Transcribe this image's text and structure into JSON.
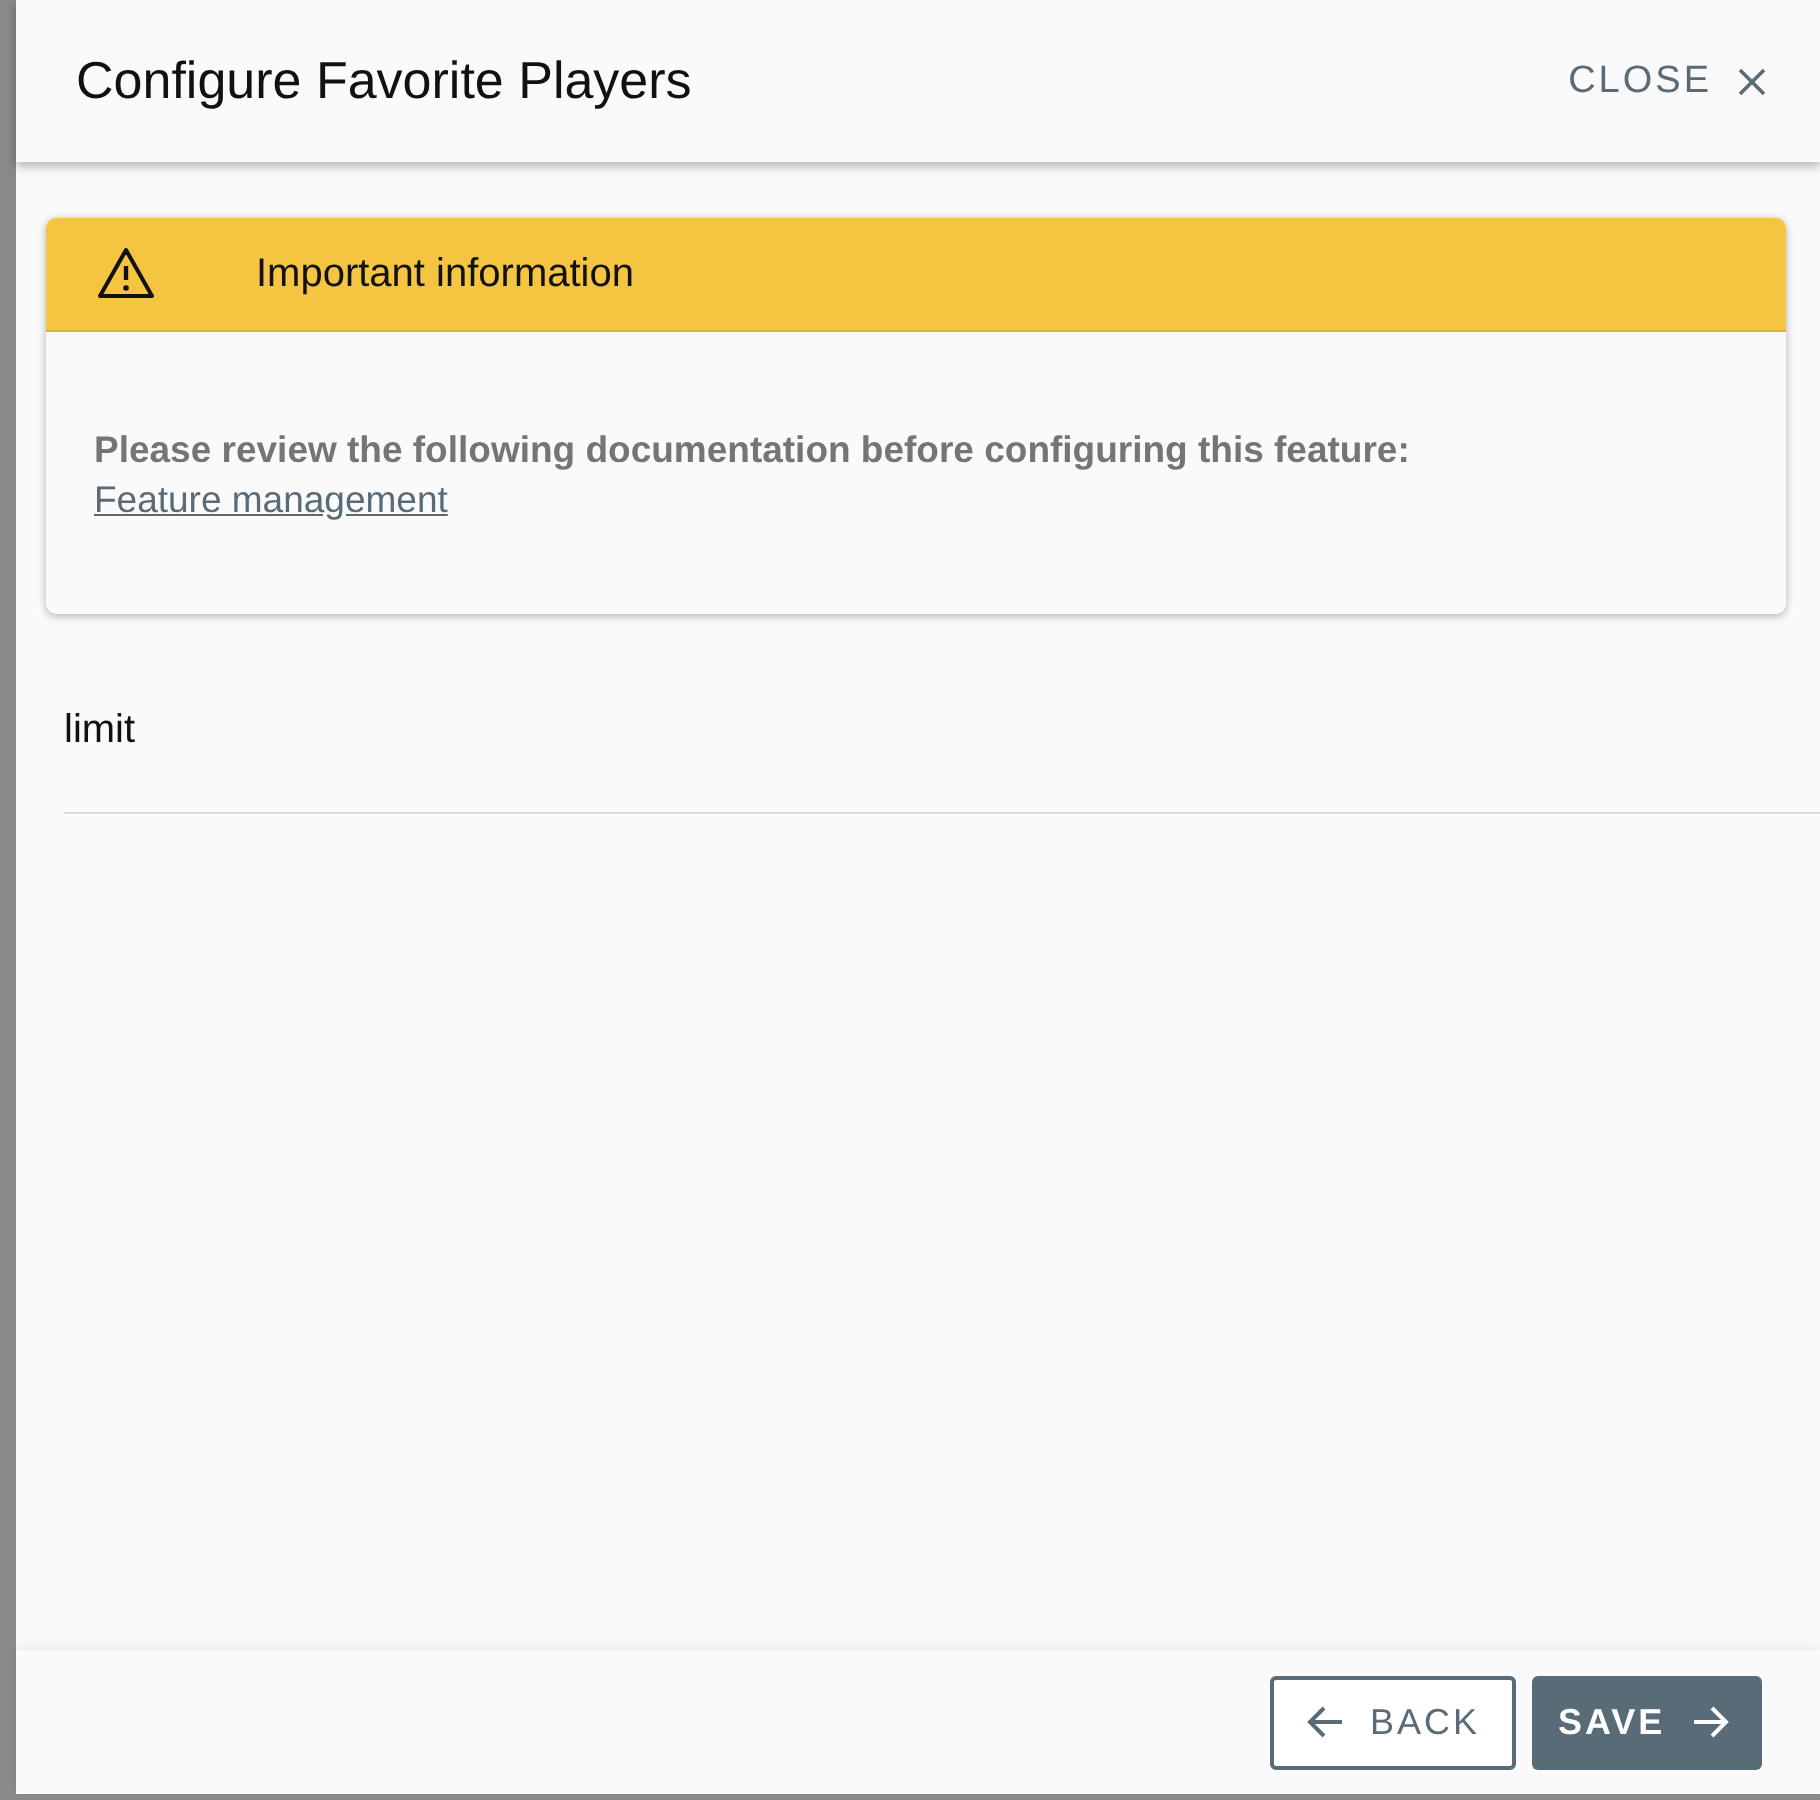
{
  "dialog": {
    "title": "Configure Favorite Players",
    "close_label": "CLOSE"
  },
  "alert": {
    "title": "Important information",
    "message": "Please review the following documentation before configuring this feature:",
    "link": "Feature management"
  },
  "field": {
    "label": "limit"
  },
  "buttons": [
    {
      "kind": "back",
      "label": "BACK"
    },
    {
      "kind": "save",
      "label": "SAVE"
    }
  ]
}
